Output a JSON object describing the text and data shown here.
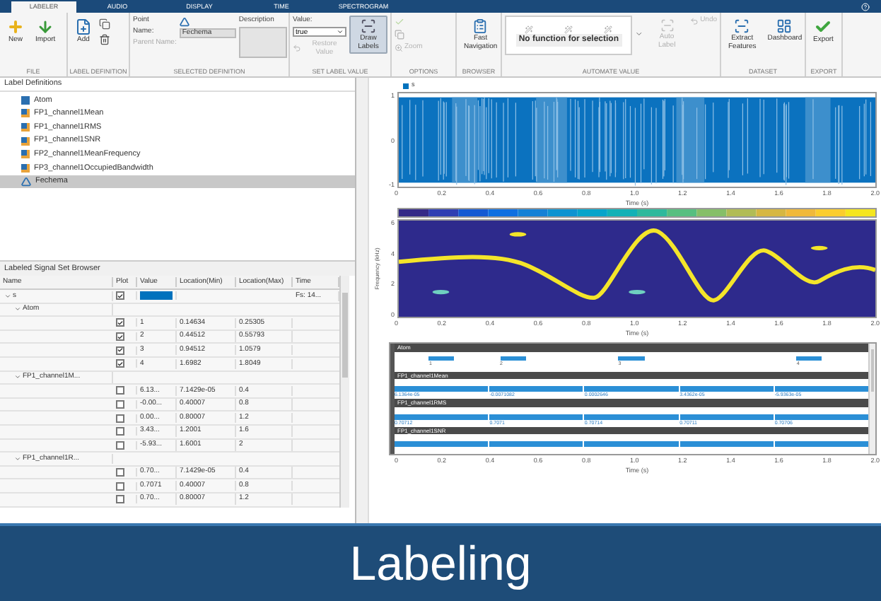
{
  "tabs": [
    {
      "label": "LABELER",
      "selected": true
    },
    {
      "label": "AUDIO",
      "selected": false
    },
    {
      "label": "DISPLAY",
      "selected": false
    },
    {
      "label": "TIME",
      "selected": false
    },
    {
      "label": "SPECTROGRAM",
      "selected": false
    }
  ],
  "toolstrip": {
    "file": {
      "title": "FILE",
      "buttons": [
        {
          "label": "New",
          "kind": "new"
        },
        {
          "label": "Import",
          "kind": "import"
        }
      ]
    },
    "label_definition": {
      "title": "LABEL DEFINITION",
      "add": "Add"
    },
    "selected_definition": {
      "title": "SELECTED DEFINITION",
      "type": "Point",
      "name_label": "Name:",
      "name": "Fechema",
      "parent_label": "Parent Name:",
      "description_label": "Description"
    },
    "set_label_value": {
      "title": "SET LABEL VALUE",
      "value_label": "Value:",
      "value": "true",
      "restore": {
        "label": "Restore Value",
        "disabled": true
      },
      "draw": {
        "label": "Draw Labels",
        "pressed": true
      }
    },
    "options": {
      "title": "OPTIONS",
      "zoom": {
        "label": "Zoom",
        "disabled": true
      }
    },
    "browser": {
      "title": "BROWSER",
      "fast": "Fast Navigation"
    },
    "automate_value": {
      "title": "AUTOMATE VALUE",
      "gallery": "No function for selection",
      "auto_label": {
        "label": "Auto Label",
        "disabled": true
      },
      "undo": {
        "label": "Undo",
        "disabled": true
      }
    },
    "dataset": {
      "title": "DATASET",
      "buttons": [
        {
          "label": "Extract Features",
          "kind": "extract"
        },
        {
          "label": "Dashboard",
          "kind": "dashboard"
        }
      ]
    },
    "export": {
      "title": "EXPORT",
      "button": "Export"
    }
  },
  "label_definitions": {
    "title": "Label Definitions",
    "items": [
      {
        "name": "Atom",
        "kind": "roi",
        "selected": false
      },
      {
        "name": "FP1_channel1Mean",
        "kind": "feature",
        "selected": false
      },
      {
        "name": "FP1_channel1RMS",
        "kind": "feature",
        "selected": false
      },
      {
        "name": "FP1_channel1SNR",
        "kind": "feature",
        "selected": false
      },
      {
        "name": "FP2_channel1MeanFrequency",
        "kind": "feature",
        "selected": false
      },
      {
        "name": "FP3_channel1OccupiedBandwidth",
        "kind": "feature",
        "selected": false
      },
      {
        "name": "Fechema",
        "kind": "point",
        "selected": true
      }
    ]
  },
  "browser": {
    "title": "Labeled Signal Set Browser",
    "columns": [
      "Name",
      "Plot",
      "Value",
      "Location(Min)",
      "Location(Max)",
      "Time"
    ],
    "rows": [
      {
        "name": "s",
        "expanded": true,
        "plot": true,
        "color": "#0072bd",
        "time": "Fs: 14...",
        "children": [
          {
            "name": "Atom",
            "expanded": true,
            "children": [
              {
                "plot": true,
                "value": "1",
                "min": "0.14634",
                "max": "0.25305"
              },
              {
                "plot": true,
                "value": "2",
                "min": "0.44512",
                "max": "0.55793"
              },
              {
                "plot": true,
                "value": "3",
                "min": "0.94512",
                "max": "1.0579"
              },
              {
                "plot": true,
                "value": "4",
                "min": "1.6982",
                "max": "1.8049"
              }
            ]
          },
          {
            "name": "FP1_channel1M...",
            "expanded": true,
            "children": [
              {
                "plot": false,
                "value": "6.13...",
                "min": "7.1429e-05",
                "max": "0.4"
              },
              {
                "plot": false,
                "value": "-0.00...",
                "min": "0.40007",
                "max": "0.8"
              },
              {
                "plot": false,
                "value": "0.00...",
                "min": "0.80007",
                "max": "1.2"
              },
              {
                "plot": false,
                "value": "3.43...",
                "min": "1.2001",
                "max": "1.6"
              },
              {
                "plot": false,
                "value": "-5.93...",
                "min": "1.6001",
                "max": "2"
              }
            ]
          },
          {
            "name": "FP1_channel1R...",
            "expanded": true,
            "children": [
              {
                "plot": false,
                "value": "0.70...",
                "min": "7.1429e-05",
                "max": "0.4"
              },
              {
                "plot": false,
                "value": "0.7071",
                "min": "0.40007",
                "max": "0.8"
              },
              {
                "plot": false,
                "value": "0.70...",
                "min": "0.80007",
                "max": "1.2"
              }
            ]
          }
        ]
      }
    ]
  },
  "signal_plot": {
    "legend": "s",
    "yticks": [
      "1",
      "0",
      "-1"
    ],
    "xticks": [
      "0",
      "0.2",
      "0.4",
      "0.6",
      "0.8",
      "1.0",
      "1.2",
      "1.4",
      "1.6",
      "1.8",
      "2.0"
    ],
    "xlabel": "Time (s)"
  },
  "spectrogram": {
    "ylabel": "Frequency (kHz)",
    "yticks": [
      "6",
      "4",
      "2",
      "0"
    ],
    "xticks": [
      "0",
      "0.2",
      "0.4",
      "0.6",
      "0.8",
      "1.0",
      "1.2",
      "1.4",
      "1.6",
      "1.8",
      "2.0"
    ],
    "xlabel": "Time (s)"
  },
  "label_lanes": {
    "lanes": [
      {
        "name": "Atom",
        "kind": "roi",
        "regions": [
          "1",
          "2",
          "3",
          "4"
        ]
      },
      {
        "name": "FP1_channel1Mean",
        "kind": "segment",
        "regions": [
          "6.1364e-05",
          "-0.0071082",
          "0.0002646",
          "3.4362e-05",
          "-5.9363e-05"
        ]
      },
      {
        "name": "FP1_channel1RMS",
        "kind": "segment",
        "regions": [
          "0.70712",
          "0.7071",
          "0.70714",
          "0.70711",
          "0.70706"
        ]
      },
      {
        "name": "FP1_channel1SNR",
        "kind": "segment"
      }
    ],
    "xticks": [
      "0",
      "0.2",
      "0.4",
      "0.6",
      "0.8",
      "1.0",
      "1.2",
      "1.4",
      "1.6",
      "1.8",
      "2.0"
    ],
    "xlabel": "Time (s)"
  },
  "banner": {
    "title": "Labeling"
  }
}
